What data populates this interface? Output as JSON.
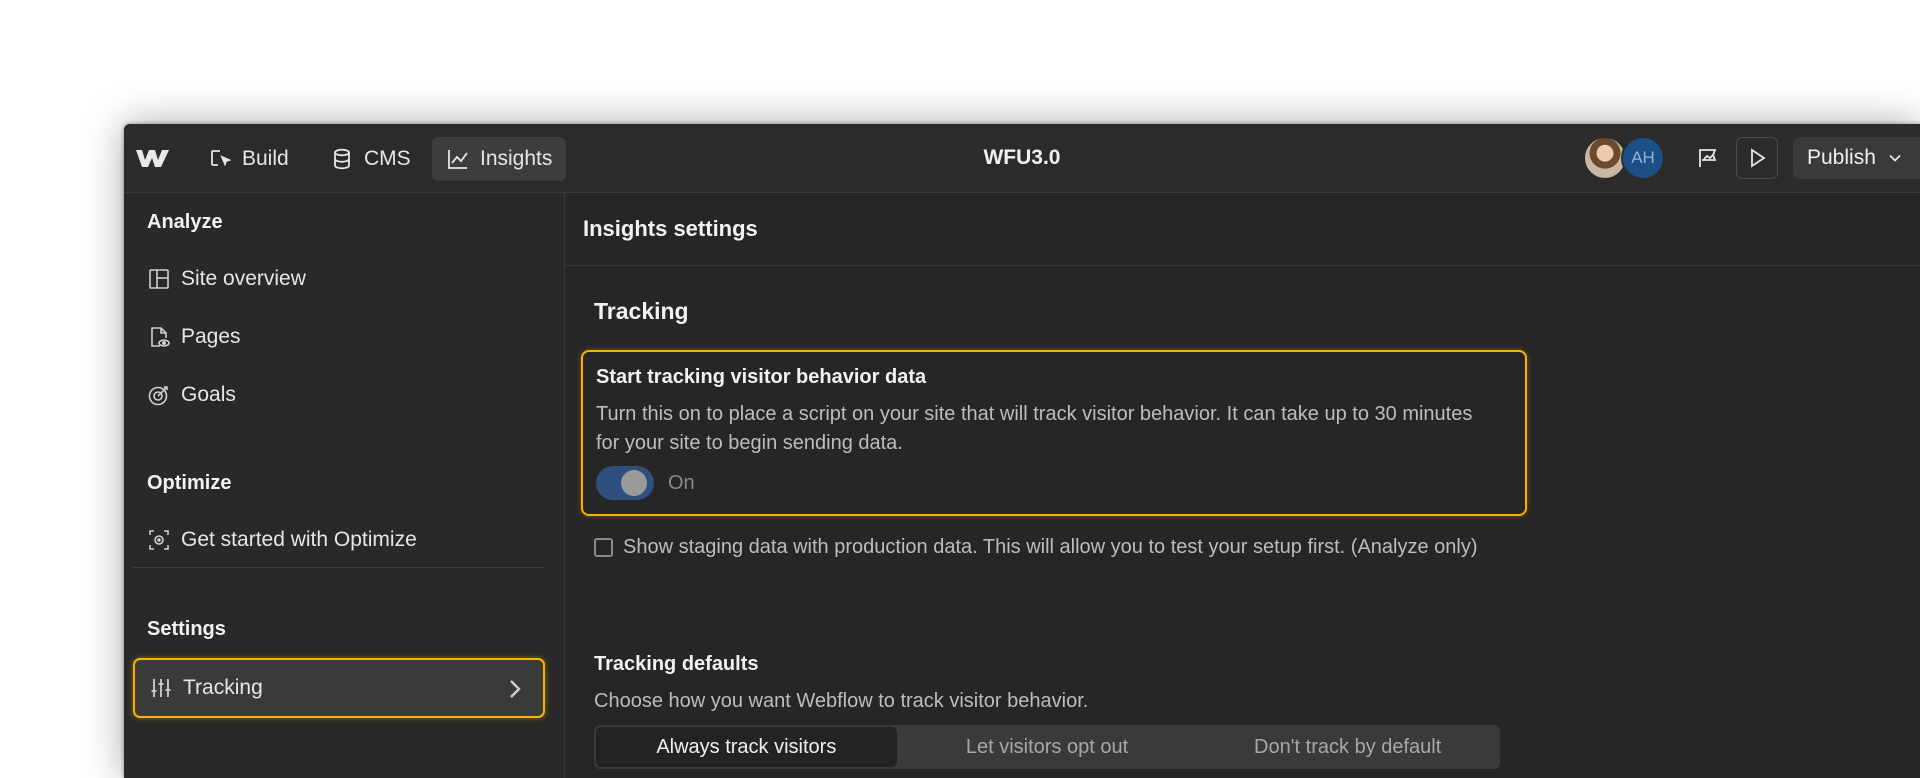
{
  "topbar": {
    "nav": [
      {
        "label": "Build",
        "icon": "cursor-select-icon"
      },
      {
        "label": "CMS",
        "icon": "database-icon"
      },
      {
        "label": "Insights",
        "icon": "line-chart-icon"
      }
    ],
    "site_title": "WFU3.0",
    "avatar_initials": "AH",
    "publish_label": "Publish"
  },
  "sidebar": {
    "analyze_title": "Analyze",
    "analyze_items": [
      {
        "label": "Site overview",
        "icon": "layout-icon"
      },
      {
        "label": "Pages",
        "icon": "page-eye-icon"
      },
      {
        "label": "Goals",
        "icon": "target-icon"
      }
    ],
    "optimize_title": "Optimize",
    "optimize_items": [
      {
        "label": "Get started with Optimize",
        "icon": "focus-target-icon"
      }
    ],
    "settings_title": "Settings",
    "settings_items": [
      {
        "label": "Tracking",
        "icon": "sliders-icon",
        "active": true
      }
    ]
  },
  "main": {
    "title": "Insights settings",
    "section_title": "Tracking",
    "card": {
      "title": "Start tracking visitor behavior data",
      "description": "Turn this on to place a script on your site that will track visitor behavior. It can take up to 30 minutes for your site to begin sending data.",
      "toggle_label": "On",
      "toggle_on": true
    },
    "staging_checkbox": {
      "label": "Show staging data with production data. This will allow you to test your setup first. (Analyze only)",
      "checked": false
    },
    "defaults": {
      "title": "Tracking defaults",
      "description": "Choose how you want Webflow to track visitor behavior.",
      "options": [
        "Always track visitors",
        "Let visitors opt out",
        "Don't track by default"
      ],
      "selected": "Always track visitors"
    }
  },
  "colors": {
    "accent_highlight": "#f5b400",
    "toggle_on": "#2f4f7f",
    "avatar_blue": "#1c4f86"
  }
}
